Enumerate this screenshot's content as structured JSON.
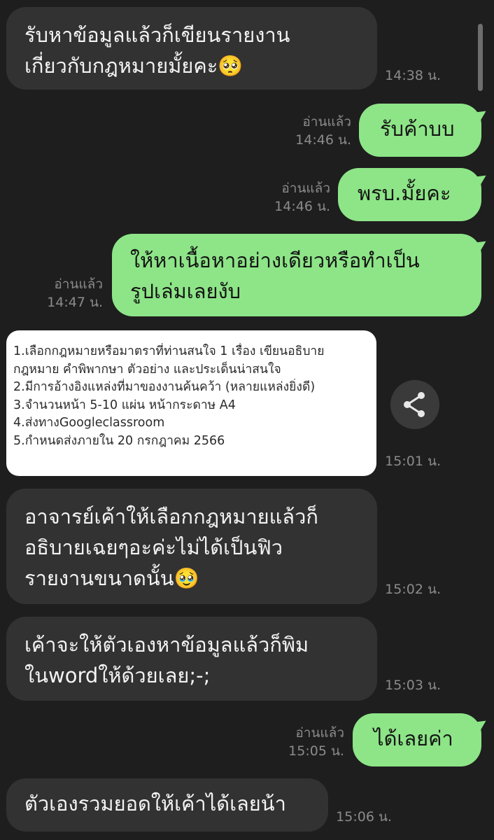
{
  "colors": {
    "background": "#1e1e1e",
    "incoming_bubble": "#323232",
    "outgoing_bubble": "#8de587",
    "meta_text": "#8b8b8b"
  },
  "messages": [
    {
      "direction": "incoming",
      "text": "รับหาข้อมูลแล้วก็เขียนรายงาน\nเกี่ยวกับกฎหมายมั้ยคะ🥺",
      "time": "14:38 น."
    },
    {
      "direction": "outgoing",
      "text": "รับค้าบบ",
      "read": "อ่านแล้ว",
      "time": "14:46 น."
    },
    {
      "direction": "outgoing",
      "text": "พรบ.มั้ยคะ",
      "read": "อ่านแล้ว",
      "time": "14:46 น."
    },
    {
      "direction": "outgoing",
      "text": "ให้หาเนื้อหาอย่างเดียวหรือทำเป็น\nรูปเล่มเลยงับ",
      "read": "อ่านแล้ว",
      "time": "14:47 น."
    },
    {
      "direction": "incoming",
      "type": "image",
      "time": "15:01 น.",
      "image_lines": [
        "1.เลือกกฎหมายหรือมาตราที่ท่านสนใจ 1 เรื่อง เขียนอธิบาย",
        "กฎหมาย คำพิพากษา ตัวอย่าง และประเด็นน่าสนใจ",
        "2.มีการอ้างอิงแหล่งที่มาของงานค้นคว้า (หลายแหล่งยิ่งดี)",
        "3.จำนวนหน้า 5-10 แผ่น หน้ากระดาษ A4",
        "4.ส่งทางGoogleclassroom",
        "5.กำหนดส่งภายใน 20 กรกฎาคม 2566"
      ],
      "share_icon": "share-icon"
    },
    {
      "direction": "incoming",
      "text": "อาจารย์เค้าให้เลือกกฎหมายแล้วก็\nอธิบายเฉยๆอะค่ะไม่ได้เป็นฟิว\nรายงานขนาดนั้น🥹",
      "time": "15:02 น."
    },
    {
      "direction": "incoming",
      "text": "เค้าจะให้ตัวเองหาข้อมูลแล้วก็พิม\nในwordให้ด้วยเลย;-;",
      "time": "15:03 น."
    },
    {
      "direction": "outgoing",
      "text": "ได้เลยค่า",
      "read": "อ่านแล้ว",
      "time": "15:05 น."
    },
    {
      "direction": "incoming",
      "text": "ตัวเองรวมยอดให้เค้าได้เลยน้า",
      "time": "15:06 น."
    }
  ]
}
